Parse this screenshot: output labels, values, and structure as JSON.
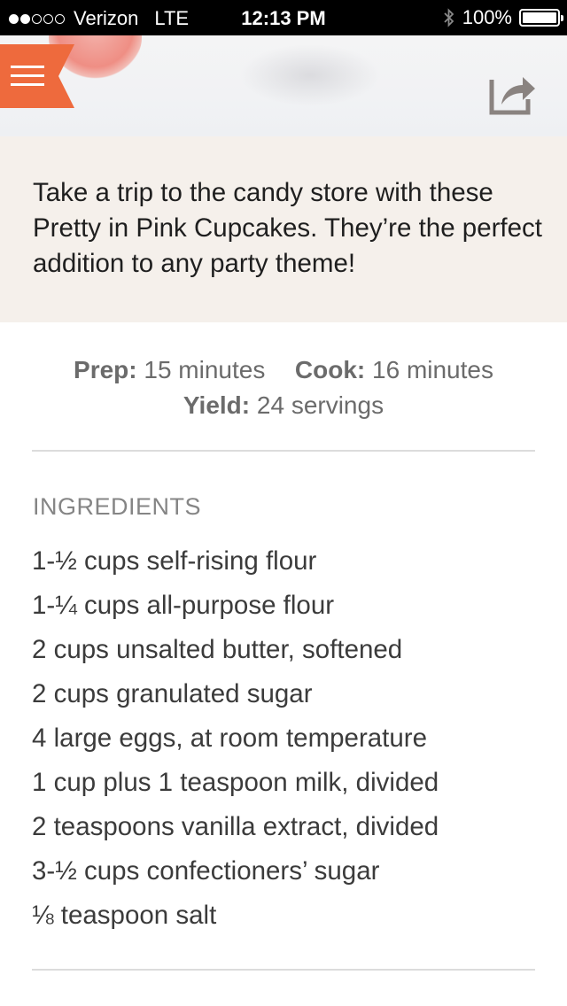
{
  "status_bar": {
    "carrier": "Verizon",
    "network": "LTE",
    "time": "12:13 PM",
    "battery_text": "100%",
    "battery_level": 1.0,
    "signal_bars_filled": 2,
    "signal_bars_total": 5,
    "icons": [
      "signal-dots-icon",
      "bluetooth-icon",
      "battery-icon"
    ]
  },
  "header": {
    "menu_icon": "hamburger-menu-icon",
    "share_icon": "share-icon",
    "accent_color": "#ee6a3d"
  },
  "intro": {
    "text": "Take a trip to the candy store with these Pretty in Pink Cupcakes. They’re the perfect addition to any party theme!"
  },
  "meta": {
    "prep_label": "Prep:",
    "prep_value": "15 minutes",
    "cook_label": "Cook:",
    "cook_value": "16 minutes",
    "yield_label": "Yield:",
    "yield_value": "24 servings"
  },
  "ingredients": {
    "title": "INGREDIENTS",
    "items": [
      "1-½ cups self-rising flour",
      "1-¼ cups all-purpose flour",
      "2 cups unsalted butter, softened",
      "2 cups granulated sugar",
      "4 large eggs, at room temperature",
      "1 cup plus 1 teaspoon milk, divided",
      "2 teaspoons vanilla extract, divided",
      "3-½ cups confectioners’ sugar",
      "⅛ teaspoon salt"
    ]
  }
}
